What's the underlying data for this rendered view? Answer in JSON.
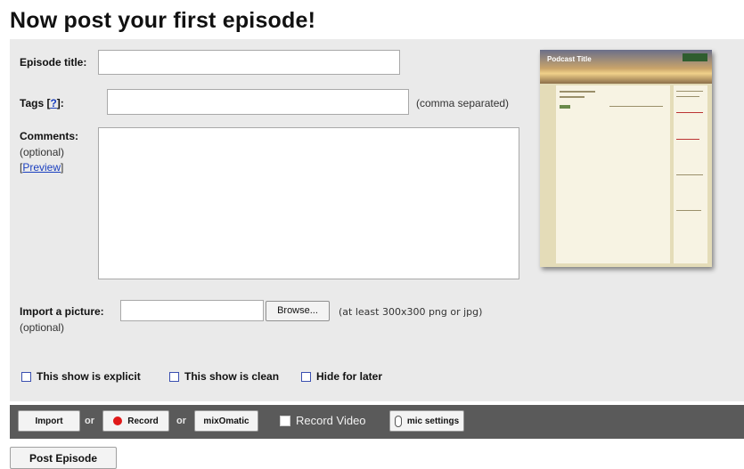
{
  "page": {
    "title": "Now post your first episode!"
  },
  "form": {
    "episode_title": {
      "label": "Episode title:",
      "value": ""
    },
    "tags": {
      "label_prefix": "Tags [",
      "help_link": "?",
      "label_suffix": "]:",
      "value": "",
      "hint": "(comma separated)"
    },
    "comments": {
      "label": "Comments:",
      "optional": "(optional)",
      "preview_link": "Preview",
      "value": ""
    },
    "picture": {
      "label": "Import a picture:",
      "optional": "(optional)",
      "value": "",
      "browse_label": "Browse...",
      "hint": "(at least 300x300 png or jpg)"
    },
    "checkboxes": [
      {
        "label": "This show is explicit",
        "checked": false
      },
      {
        "label": "This show is clean",
        "checked": false
      },
      {
        "label": "Hide for later",
        "checked": false
      }
    ]
  },
  "preview_thumbnail": {
    "title": "Podcast Title",
    "colors": {
      "sky": "#c9a46a",
      "page": "#e4dcb8"
    }
  },
  "toolbar": {
    "import_label": "Import",
    "or_1": "or",
    "record_label": "Record",
    "or_2": "or",
    "mixomatic_label": "mixOmatic",
    "record_video_label": "Record Video",
    "record_video_checked": false,
    "mic_settings_label": "mic settings",
    "colors": {
      "bar": "#5a5a5a",
      "record_dot": "#e01919"
    }
  },
  "post_button": {
    "label": "Post Episode"
  }
}
